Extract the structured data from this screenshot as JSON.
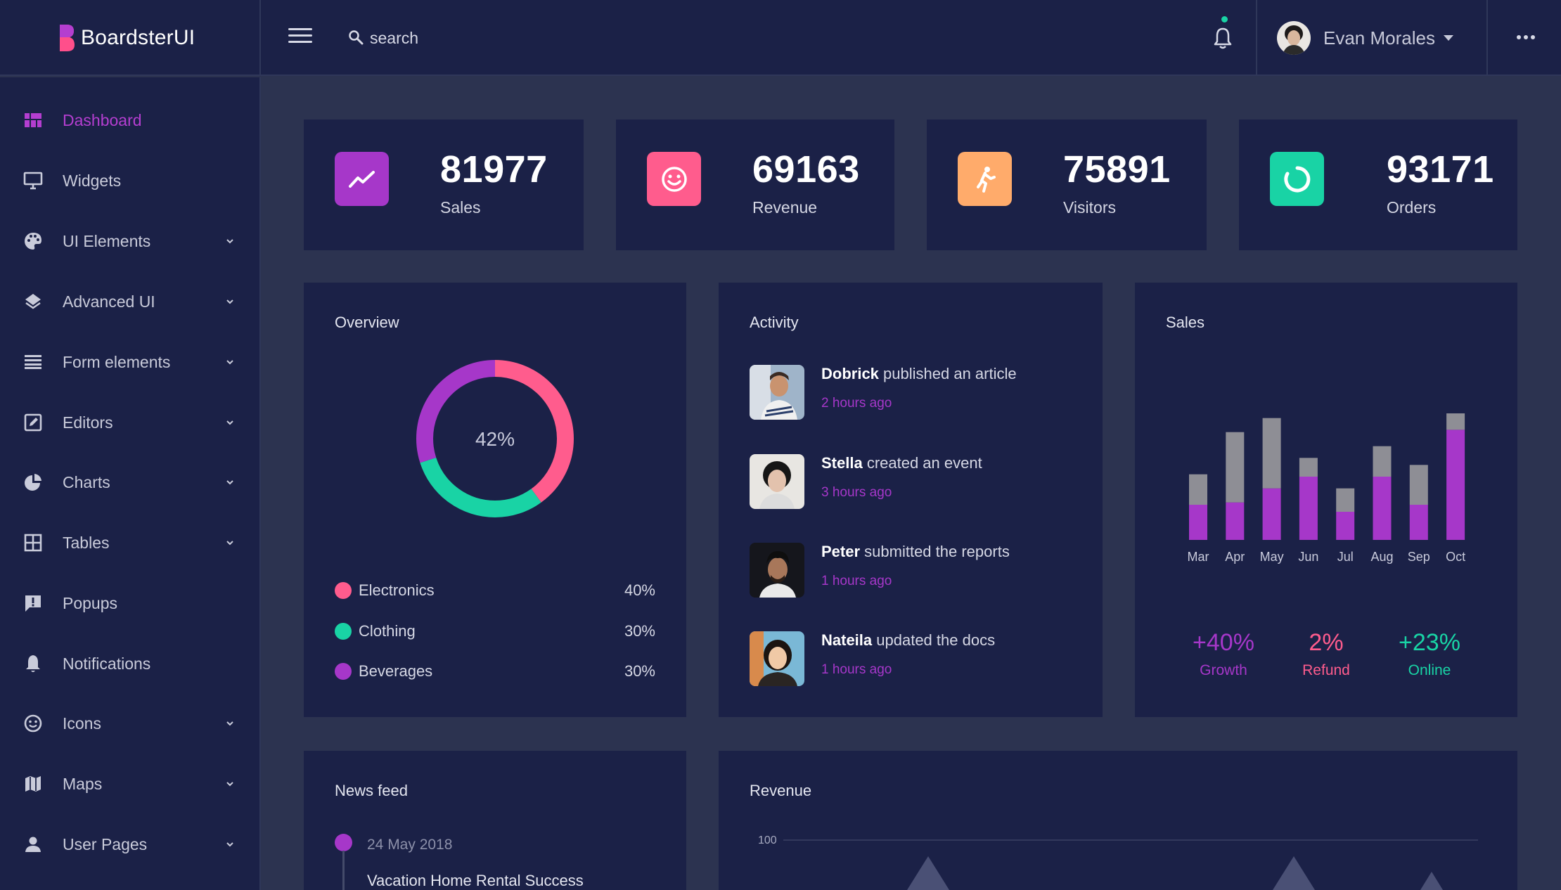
{
  "brand": {
    "name": "BoardsterUI",
    "accent": "#ff4f8b"
  },
  "header": {
    "search_placeholder": "search",
    "user_name": "Evan Morales",
    "notification_dot_color": "#19d3a5"
  },
  "sidebar": {
    "items": [
      {
        "label": "Dashboard",
        "icon": "dashboard-icon",
        "active": true,
        "has_submenu": false
      },
      {
        "label": "Widgets",
        "icon": "monitor-icon",
        "active": false,
        "has_submenu": false
      },
      {
        "label": "UI Elements",
        "icon": "palette-icon",
        "active": false,
        "has_submenu": true
      },
      {
        "label": "Advanced UI",
        "icon": "layers-icon",
        "active": false,
        "has_submenu": true
      },
      {
        "label": "Form elements",
        "icon": "list-icon",
        "active": false,
        "has_submenu": true
      },
      {
        "label": "Editors",
        "icon": "edit-icon",
        "active": false,
        "has_submenu": true
      },
      {
        "label": "Charts",
        "icon": "pie-chart-icon",
        "active": false,
        "has_submenu": true
      },
      {
        "label": "Tables",
        "icon": "table-icon",
        "active": false,
        "has_submenu": true
      },
      {
        "label": "Popups",
        "icon": "alert-message-icon",
        "active": false,
        "has_submenu": false
      },
      {
        "label": "Notifications",
        "icon": "bell-icon",
        "active": false,
        "has_submenu": false
      },
      {
        "label": "Icons",
        "icon": "smiley-icon",
        "active": false,
        "has_submenu": true
      },
      {
        "label": "Maps",
        "icon": "map-icon",
        "active": false,
        "has_submenu": true
      },
      {
        "label": "User Pages",
        "icon": "user-icon",
        "active": false,
        "has_submenu": true
      }
    ]
  },
  "stats": [
    {
      "value": "81977",
      "label": "Sales",
      "icon": "trending-up-icon",
      "color": "#a637c9"
    },
    {
      "value": "69163",
      "label": "Revenue",
      "icon": "smiley-icon",
      "color": "#ff5c8d"
    },
    {
      "value": "75891",
      "label": "Visitors",
      "icon": "runner-icon",
      "color": "#ffab6b"
    },
    {
      "value": "93171",
      "label": "Orders",
      "icon": "loading-ring-icon",
      "color": "#19d3a5"
    }
  ],
  "overview": {
    "title": "Overview",
    "center_label": "42%",
    "legend": [
      {
        "label": "Electronics",
        "pct": "40%",
        "color": "#ff5c8d"
      },
      {
        "label": "Clothing",
        "pct": "30%",
        "color": "#19d3a5"
      },
      {
        "label": "Beverages",
        "pct": "30%",
        "color": "#a637c9"
      }
    ]
  },
  "activity": {
    "title": "Activity",
    "items": [
      {
        "name": "Dobrick",
        "action": " published an article",
        "time": "2 hours ago"
      },
      {
        "name": "Stella",
        "action": " created an event",
        "time": "3 hours ago"
      },
      {
        "name": "Peter",
        "action": " submitted the reports",
        "time": "1 hours ago"
      },
      {
        "name": "Nateila",
        "action": " updated the docs",
        "time": "1 hours ago"
      }
    ]
  },
  "sales": {
    "title": "Sales",
    "stats": [
      {
        "value": "+40%",
        "label": "Growth",
        "color": "#a637c9"
      },
      {
        "value": "2%",
        "label": "Refund",
        "color": "#ff5c8d"
      },
      {
        "value": "+23%",
        "label": "Online",
        "color": "#19d3a5"
      }
    ]
  },
  "chart_data": [
    {
      "type": "pie",
      "title": "Overview",
      "labels": [
        "Electronics",
        "Clothing",
        "Beverages"
      ],
      "values": [
        40,
        30,
        30
      ],
      "colors": [
        "#ff5c8d",
        "#19d3a5",
        "#a637c9"
      ],
      "center_text": "42%"
    },
    {
      "type": "bar",
      "title": "Sales",
      "stacked": true,
      "categories": [
        "Mar",
        "Apr",
        "May",
        "Jun",
        "Jul",
        "Aug",
        "Sep",
        "Oct"
      ],
      "series": [
        {
          "values": [
            15,
            16,
            22,
            27,
            12,
            27,
            15,
            47
          ],
          "color": "#a637c9"
        },
        {
          "values": [
            13,
            30,
            30,
            8,
            10,
            13,
            17,
            7
          ],
          "color": "#8e8e95"
        }
      ],
      "ylim": [
        0,
        60
      ]
    }
  ],
  "newsfeed": {
    "title": "News feed",
    "items": [
      {
        "date": "24 May 2018",
        "title": "Vacation Home Rental Success"
      }
    ]
  },
  "revenue": {
    "title": "Revenue",
    "y_tick": "100"
  }
}
